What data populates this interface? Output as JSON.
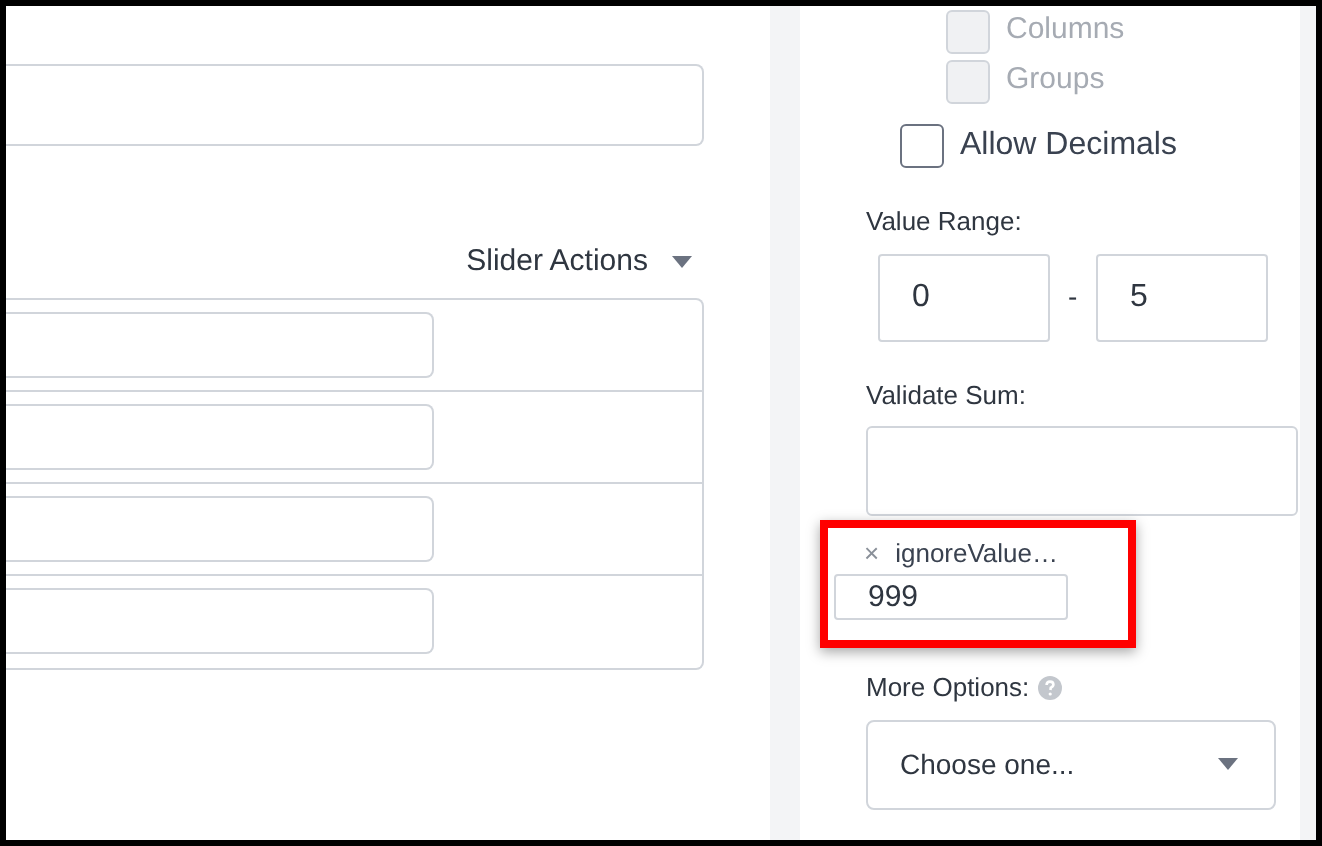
{
  "slider_actions": {
    "label": "Slider Actions"
  },
  "settings": {
    "checkboxes": [
      {
        "label": "Columns",
        "checked": false,
        "disabled": true
      },
      {
        "label": "Groups",
        "checked": false,
        "disabled": true
      },
      {
        "label": "Allow Decimals",
        "checked": false,
        "disabled": false
      }
    ],
    "value_range": {
      "label": "Value Range:",
      "min": "0",
      "separator": "-",
      "max": "5"
    },
    "validate_sum": {
      "label": "Validate Sum:"
    },
    "ignore_value": {
      "remove": "×",
      "tag": "ignoreValue…",
      "value": "999"
    },
    "more_options": {
      "label": "More Options:",
      "select": "Choose one..."
    }
  }
}
